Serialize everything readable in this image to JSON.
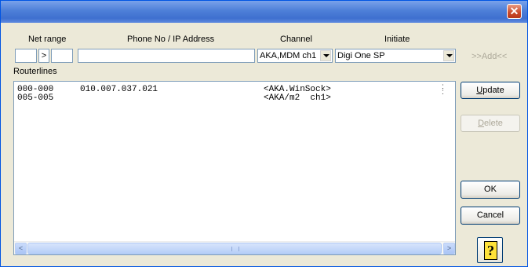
{
  "window": {
    "close_glyph": "✕"
  },
  "headers": {
    "net_range": "Net range",
    "phone_ip": "Phone No / IP Address",
    "channel": "Channel",
    "initiate": "Initiate"
  },
  "inputs": {
    "net_from": "",
    "net_arrow": ">",
    "net_to": "",
    "phone_ip": "",
    "channel_selected": "AKA,MDM ch1",
    "initiate_selected": "Digi One SP"
  },
  "routerlines_label": "Routerlines",
  "routerlines": [
    {
      "range": "000-000",
      "address": "010.007.037.021",
      "channel": "<AKA.WinSock>"
    },
    {
      "range": "005-005",
      "address": "",
      "channel": "<AKA/m2  ch1>"
    }
  ],
  "buttons": {
    "add": ">>Add<<",
    "update_u": "U",
    "update_rest": "pdate",
    "delete_u": "D",
    "delete_rest": "elete",
    "ok": "OK",
    "cancel": "Cancel",
    "help": "?"
  },
  "scrollbar": {
    "left_glyph": "<",
    "right_glyph": ">"
  },
  "icons": [
    "close-icon",
    "dropdown-arrow-icon",
    "scroll-left-icon",
    "scroll-right-icon",
    "help-icon"
  ]
}
